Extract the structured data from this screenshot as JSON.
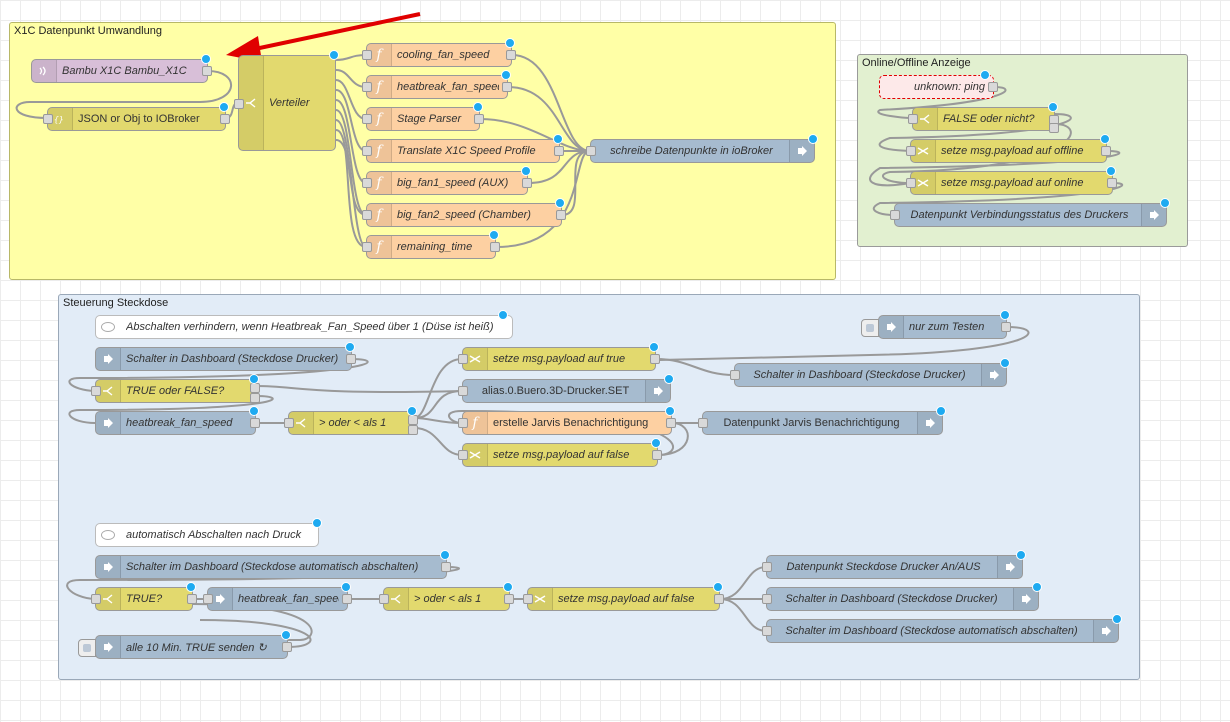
{
  "groups": {
    "x1c": {
      "label": "X1C Datenpunkt Umwandlung",
      "bg": "#ffffa6",
      "border": "#b0b05a"
    },
    "online": {
      "label": "Online/Offline Anzeige",
      "bg": "#e2f0d0",
      "border": "#9a9a9a"
    },
    "steckdose": {
      "label": "Steuerung Steckdose",
      "bg": "#e2ecf7",
      "border": "#9aa8b8"
    }
  },
  "colors": {
    "mqtt": "#d8bfd8",
    "function": "#fdd0a2",
    "change": "#e2d96e",
    "iobroker": "#a6bbcf",
    "annotation_arrow": "#e00000",
    "wire": "#999999",
    "status_dot": "#1eaaf1"
  },
  "nodes": {
    "bambu": "Bambu X1C Bambu_X1C",
    "json_obj": "JSON or Obj to IOBroker",
    "verteiler": "Verteiler",
    "cooling": "cooling_fan_speed",
    "heatbreak": "heatbreak_fan_speed",
    "stage": "Stage Parser",
    "translate": "Translate X1C Speed Profile",
    "big1": "big_fan1_speed (AUX)",
    "big2": "big_fan2_speed (Chamber)",
    "remaining": "remaining_time",
    "schreibe": "schreibe Datenpunkte in ioBroker",
    "unknown_ping": "unknown: ping",
    "false_oder": "FALSE oder nicht?",
    "set_offline": "setze msg.payload auf offline",
    "set_online": "setze msg.payload auf online",
    "dp_verbindung": "Datenpunkt Verbindungsstatus des Druckers",
    "comment1": "Abschalten verhindern, wenn Heatbreak_Fan_Speed über 1 (Düse ist heiß)",
    "nur_testen": "nur zum Testen",
    "schalter_dash1": "Schalter in Dashboard (Steckdose Drucker)",
    "set_true": "setze msg.payload auf true",
    "schalter_dash_out1": "Schalter in Dashboard (Steckdose Drucker)",
    "true_false": "TRUE oder FALSE?",
    "alias": "alias.0.Buero.3D-Drucker.SET",
    "heatbreak_in": "heatbreak_fan_speed",
    "groesser1": "> oder < als 1",
    "jarvis": "erstelle Jarvis Benachrichtigung",
    "dp_jarvis": "Datenpunkt Jarvis Benachrichtigung",
    "set_false1": "setze msg.payload auf false",
    "comment2": "automatisch Abschalten nach Druck",
    "schalter_auto_in": "Schalter im Dashboard (Steckdose automatisch abschalten)",
    "true_q": "TRUE?",
    "heatbreak2": "heatbreak_fan_speed",
    "groesser2": "> oder < als 1",
    "set_false2": "setze msg.payload auf false",
    "dp_steckdose": "Datenpunkt Steckdose Drucker An/AUS",
    "schalter_dash_out2": "Schalter in Dashboard (Steckdose Drucker)",
    "schalter_auto_out": "Schalter im Dashboard (Steckdose automatisch abschalten)",
    "alle10": "alle 10 Min. TRUE senden ↻"
  }
}
